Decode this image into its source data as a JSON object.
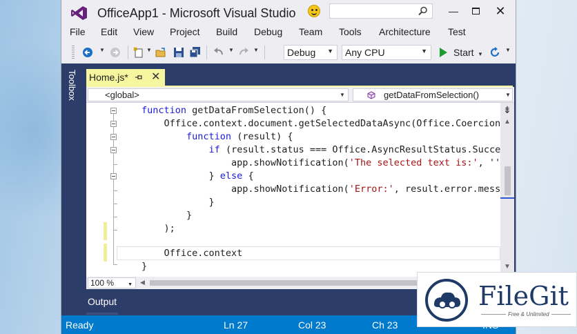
{
  "window": {
    "title": "OfficeApp1 - Microsoft Visual Studio",
    "search_placeholder": "",
    "minimize": "—",
    "close": "✕"
  },
  "menu": [
    "File",
    "Edit",
    "View",
    "Project",
    "Build",
    "Debug",
    "Team",
    "Tools",
    "Architecture",
    "Test"
  ],
  "toolbar": {
    "config": "Debug",
    "platform": "Any CPU",
    "start_label": "Start"
  },
  "side": {
    "toolbox_label": "Toolbox"
  },
  "tab": {
    "filename": "Home.js*",
    "close": "✕"
  },
  "nav": {
    "scope": "<global>",
    "member": "getDataFromSelection()"
  },
  "code": {
    "lines": [
      {
        "kw1": "function",
        "rest": " getDataFromSelection() {"
      },
      {
        "plain": "    Office.context.document.getSelectedDataAsync(Office.Coercion"
      },
      {
        "kw1": "function",
        "rest": " (result) {",
        "indent": "        "
      },
      {
        "kw1": "if",
        "rest": " (result.status === Office.AsyncResultStatus.Succe",
        "indent": "            "
      },
      {
        "pre": "                app.showNotification(",
        "str": "'The selected text is:'",
        "post": ", ''"
      },
      {
        "pre": "            } ",
        "kw1": "else",
        "rest": " {"
      },
      {
        "pre": "                app.showNotification(",
        "str": "'Error:'",
        "post": ", result.error.mess"
      },
      {
        "plain": "            }"
      },
      {
        "plain": "        }"
      },
      {
        "plain": "    );"
      },
      {
        "plain": ""
      },
      {
        "plain": "    Office.context"
      },
      {
        "plain": "}"
      }
    ]
  },
  "editor": {
    "zoom": "100 %"
  },
  "output_label": "Output",
  "status": {
    "state": "Ready",
    "line": "Ln 27",
    "col": "Col 23",
    "ch": "Ch 23",
    "mode": "INS"
  },
  "watermark": {
    "title": "FileGit",
    "subtitle": "Free & Unlimited"
  },
  "colors": {
    "accent_blue": "#007acc",
    "frame_navy": "#2d3d6a",
    "tab_yellow": "#f6f6a0",
    "vs_purple": "#68217a"
  }
}
